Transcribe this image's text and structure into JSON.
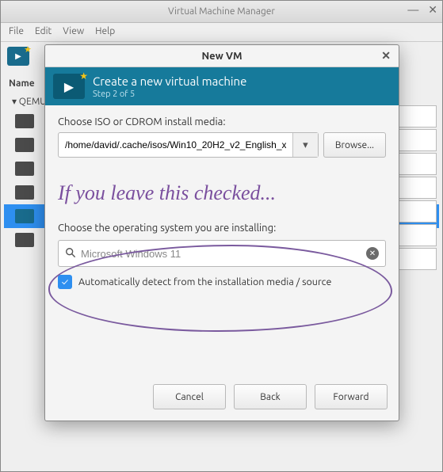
{
  "main": {
    "title": "Virtual Machine Manager",
    "menu": {
      "file": "File",
      "edit": "Edit",
      "view": "View",
      "help": "Help"
    },
    "column_header": "Name",
    "host_label": "QEMU"
  },
  "dialog": {
    "title": "New VM",
    "header": {
      "title": "Create a new virtual machine",
      "step": "Step 2 of 5"
    },
    "iso_label": "Choose ISO or CDROM install media:",
    "iso_value": "/home/david/.cache/isos/Win10_20H2_v2_English_x",
    "browse": "Browse...",
    "annotation": "If you leave this checked...",
    "os_label": "Choose the operating system you are installing:",
    "os_search_value": "Microsoft Windows 11",
    "autodetect_label": "Automatically detect from the installation media / source",
    "autodetect_checked": true,
    "buttons": {
      "cancel": "Cancel",
      "back": "Back",
      "forward": "Forward"
    }
  }
}
